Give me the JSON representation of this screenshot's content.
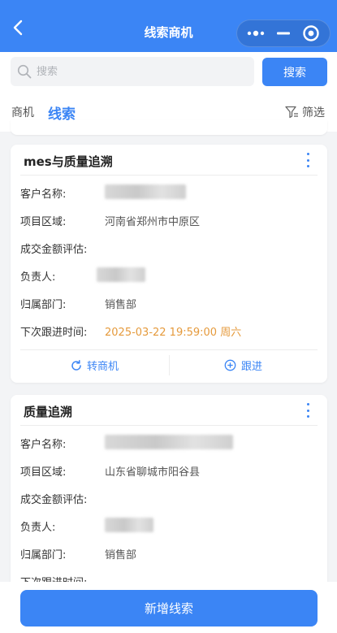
{
  "nav": {
    "title": "线索商机",
    "back_icon": "chevron-left-icon",
    "capsule_icons": [
      "more-dots-icon",
      "minimize-icon",
      "target-icon"
    ]
  },
  "search": {
    "placeholder": "搜索",
    "value": "",
    "button_label": "搜索"
  },
  "tabs": {
    "items": [
      {
        "label": "商机",
        "active": false
      },
      {
        "label": "线索",
        "active": true
      }
    ],
    "filter_label": "筛选"
  },
  "cards": [
    {
      "title": "mes与质量追溯",
      "fields": [
        {
          "label": "客户名称:",
          "value": ""
        },
        {
          "label": "项目区域:",
          "value": "河南省郑州市中原区"
        },
        {
          "label": "成交金额评估:",
          "value": ""
        },
        {
          "label": "负责人:",
          "value": ""
        },
        {
          "label": "归属部门:",
          "value": "销售部"
        },
        {
          "label": "下次跟进时间:",
          "value": "2025-03-22 19:59:00 周六"
        }
      ],
      "actions": [
        {
          "label": "转商机",
          "icon": "refresh-icon"
        },
        {
          "label": "跟进",
          "icon": "plus-circle-icon"
        }
      ]
    },
    {
      "title": "质量追溯",
      "fields": [
        {
          "label": "客户名称:",
          "value": ""
        },
        {
          "label": "项目区域:",
          "value": "山东省聊城市阳谷县"
        },
        {
          "label": "成交金额评估:",
          "value": ""
        },
        {
          "label": "负责人:",
          "value": ""
        },
        {
          "label": "归属部门:",
          "value": "销售部"
        },
        {
          "label": "下次跟进时间:",
          "value": ""
        }
      ]
    }
  ],
  "bottom": {
    "add_label": "新增线索"
  },
  "colors": {
    "accent": "#3b85f5",
    "date": "#e59a3c",
    "background": "#f3f4f6"
  }
}
